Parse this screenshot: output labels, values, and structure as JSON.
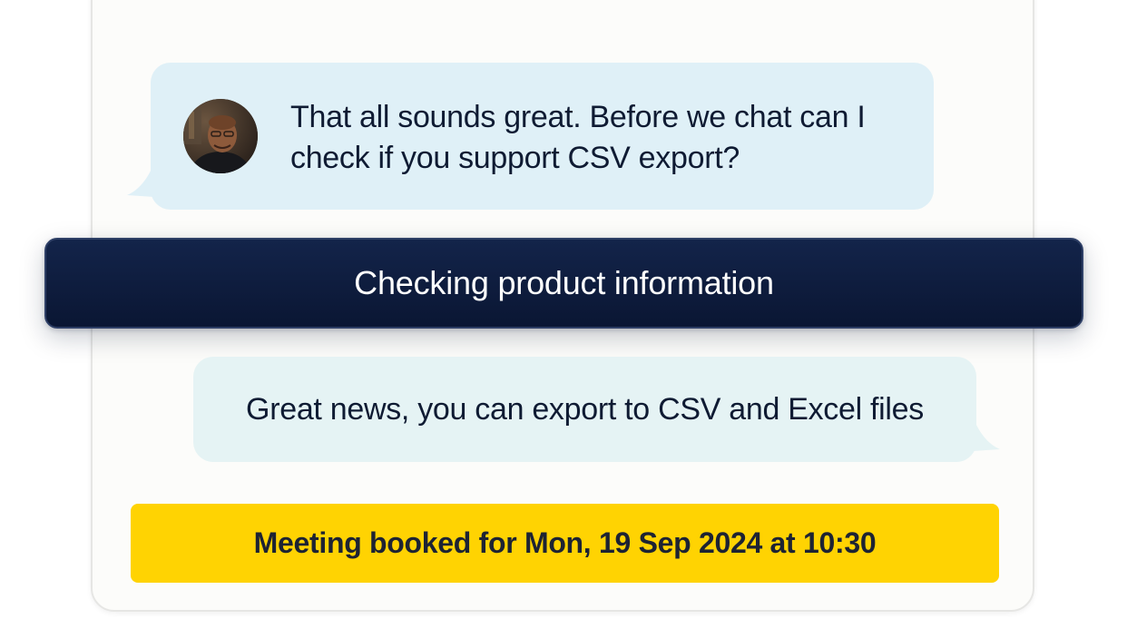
{
  "conversation": {
    "user_message": "That all sounds great. Before we chat can I check if you support CSV export?",
    "status": "Checking product information",
    "bot_message": "Great news, you can export to CSV and Excel files",
    "booking": "Meeting booked for Mon, 19 Sep 2024 at 10:30"
  },
  "colors": {
    "user_bubble": "#dff0f7",
    "bot_bubble": "#e5f3f4",
    "status_bar": "#0a1633",
    "booking_banner": "#ffd302",
    "text": "#0f1b33"
  },
  "icons": {
    "avatar": "user-avatar-photo"
  }
}
